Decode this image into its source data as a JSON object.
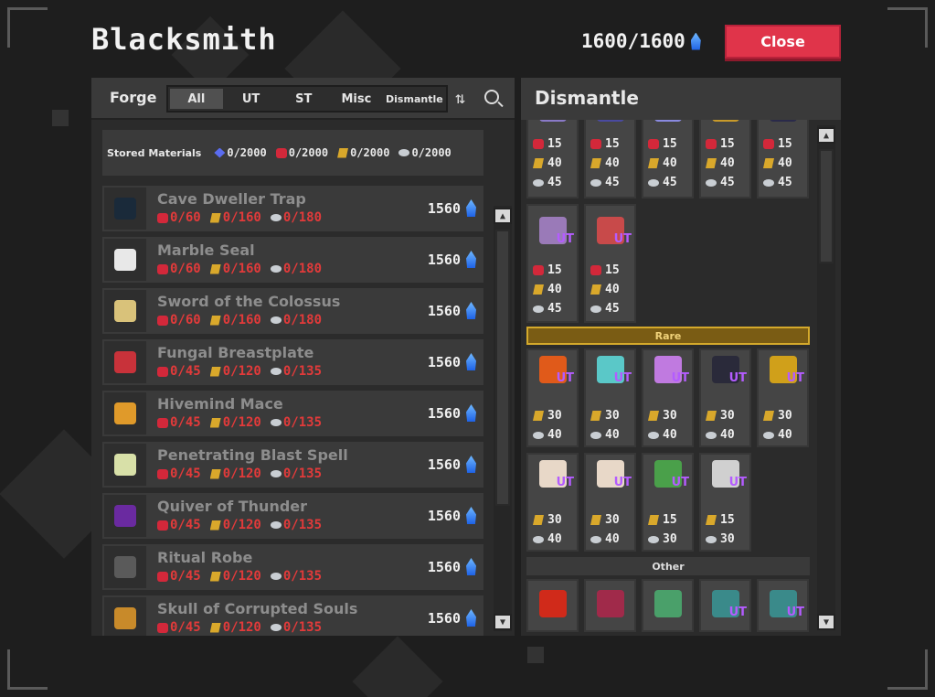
{
  "header": {
    "title": "Blacksmith",
    "currency": "1600/1600",
    "close_label": "Close"
  },
  "forge": {
    "label": "Forge",
    "tabs": [
      "All",
      "UT",
      "ST",
      "Misc",
      "Dismantle"
    ],
    "active_tab": "All"
  },
  "stored": {
    "label": "Stored Materials",
    "values": [
      "0/2000",
      "0/2000",
      "0/2000",
      "0/2000"
    ]
  },
  "recipes": [
    {
      "name": "Cave Dweller Trap",
      "costs": [
        "0/60",
        "0/160",
        "0/180"
      ],
      "price": "1560",
      "color": "#1a2a3a"
    },
    {
      "name": "Marble Seal",
      "costs": [
        "0/60",
        "0/160",
        "0/180"
      ],
      "price": "1560",
      "color": "#e8e8e8"
    },
    {
      "name": "Sword of the Colossus",
      "costs": [
        "0/60",
        "0/160",
        "0/180"
      ],
      "price": "1560",
      "color": "#d9c27a"
    },
    {
      "name": "Fungal Breastplate",
      "costs": [
        "0/45",
        "0/120",
        "0/135"
      ],
      "price": "1560",
      "color": "#c8323a"
    },
    {
      "name": "Hivemind Mace",
      "costs": [
        "0/45",
        "0/120",
        "0/135"
      ],
      "price": "1560",
      "color": "#e09a2a"
    },
    {
      "name": "Penetrating Blast Spell",
      "costs": [
        "0/45",
        "0/120",
        "0/135"
      ],
      "price": "1560",
      "color": "#d8e0a8"
    },
    {
      "name": "Quiver of Thunder",
      "costs": [
        "0/45",
        "0/120",
        "0/135"
      ],
      "price": "1560",
      "color": "#6a2aa0"
    },
    {
      "name": "Ritual Robe",
      "costs": [
        "0/45",
        "0/120",
        "0/135"
      ],
      "price": "1560",
      "color": "#5a5a5a"
    },
    {
      "name": "Skull of Corrupted Souls",
      "costs": [
        "0/45",
        "0/120",
        "0/135"
      ],
      "price": "1560",
      "color": "#c88a2a"
    }
  ],
  "dismantle": {
    "title": "Dismantle",
    "rare_label": "Rare",
    "other_label": "Other",
    "ut_badge": "UT",
    "top_partial": [
      {
        "vals": [
          "15",
          "40",
          "45"
        ],
        "color": "#8a7ac8"
      },
      {
        "vals": [
          "15",
          "40",
          "45"
        ],
        "color": "#4a4aa0"
      },
      {
        "vals": [
          "15",
          "40",
          "45"
        ],
        "color": "#8a8ae0"
      },
      {
        "vals": [
          "15",
          "40",
          "45"
        ],
        "color": "#c89a2a"
      },
      {
        "vals": [
          "15",
          "40",
          "45"
        ],
        "color": "#2a2a4a"
      }
    ],
    "second_row": [
      {
        "vals": [
          "15",
          "40",
          "45"
        ],
        "color": "#9a7ab8"
      },
      {
        "vals": [
          "15",
          "40",
          "45"
        ],
        "color": "#c84a4a"
      }
    ],
    "rare_row1": [
      {
        "vals": [
          "30",
          "40"
        ],
        "color": "#e05a1a"
      },
      {
        "vals": [
          "30",
          "40"
        ],
        "color": "#5ac8c8"
      },
      {
        "vals": [
          "30",
          "40"
        ],
        "color": "#c07ae0"
      },
      {
        "vals": [
          "30",
          "40"
        ],
        "color": "#2a2a3a"
      },
      {
        "vals": [
          "30",
          "40"
        ],
        "color": "#d0a01a"
      }
    ],
    "rare_row2": [
      {
        "vals": [
          "30",
          "40"
        ],
        "color": "#e8d8c8"
      },
      {
        "vals": [
          "30",
          "40"
        ],
        "color": "#e8d8c8"
      },
      {
        "vals": [
          "15",
          "30"
        ],
        "color": "#4aa04a"
      },
      {
        "vals": [
          "15",
          "30"
        ],
        "color": "#d0d0d0"
      }
    ],
    "other_row": [
      {
        "color": "#d02a1a",
        "ut": false
      },
      {
        "color": "#a02a4a",
        "ut": false
      },
      {
        "color": "#4aa06a",
        "ut": false
      },
      {
        "color": "#3a8a8a",
        "ut": true
      },
      {
        "color": "#3a8a8a",
        "ut": true
      }
    ]
  },
  "colors": {
    "close": "#e0344a",
    "cost_red": "#e23a3a",
    "ut_purple": "#b45cff",
    "rare_gold": "#d4a92b"
  },
  "icons": {
    "currency": "blue-flame-icon",
    "material_1": "blue-gem-icon",
    "material_2": "red-essence-icon",
    "material_3": "gold-ingot-icon",
    "material_4": "silver-ore-icon"
  }
}
